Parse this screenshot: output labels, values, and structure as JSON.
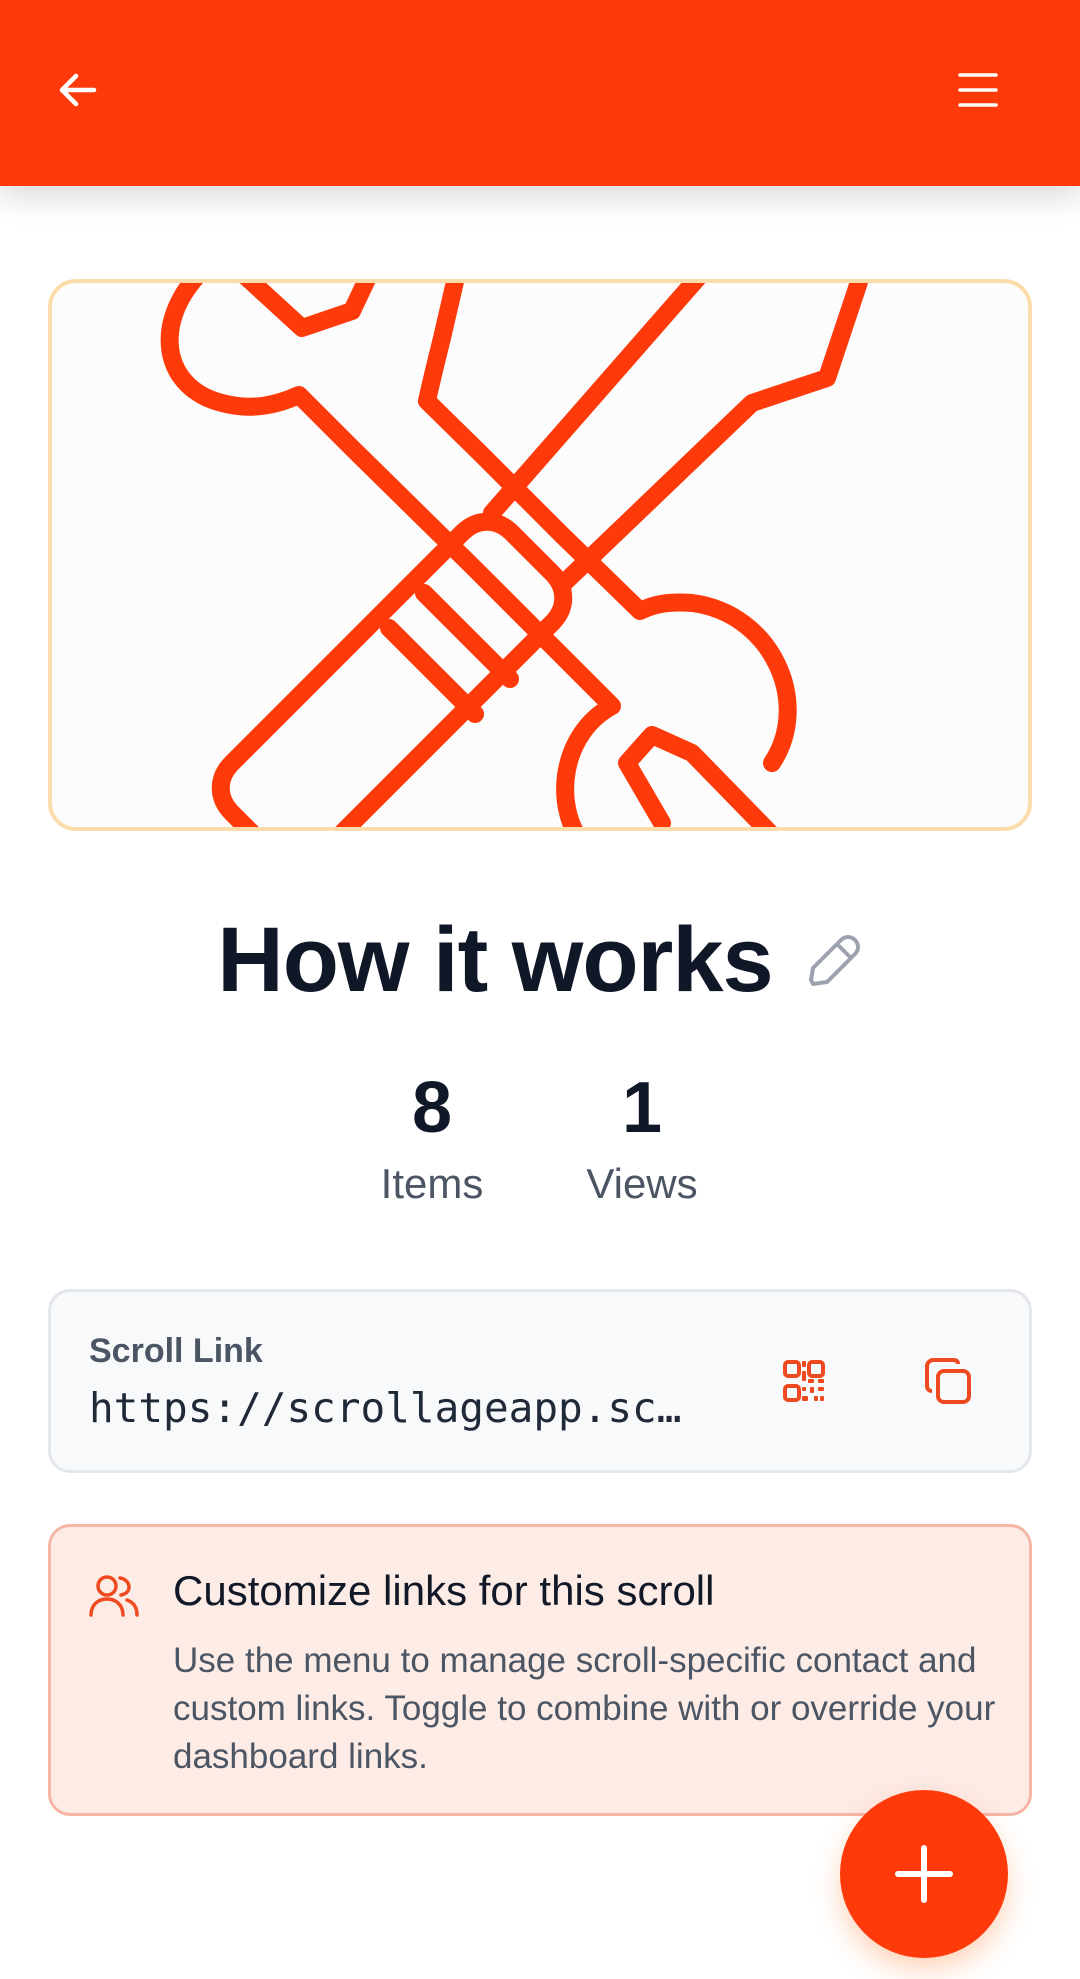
{
  "header": {
    "back_icon": "arrow-left-icon",
    "menu_icon": "hamburger-menu-icon",
    "background_color": "#ff3a0a"
  },
  "hero": {
    "image_icon": "wrench-and-screwdriver-icon",
    "border_color": "#fcdcaa",
    "icon_color": "#ff3a0a"
  },
  "scroll": {
    "title": "How it works",
    "edit_icon": "pencil-icon"
  },
  "stats": [
    {
      "value": "8",
      "label": "Items"
    },
    {
      "value": "1",
      "label": "Views"
    }
  ],
  "scroll_link": {
    "label": "Scroll Link",
    "url": "https://scrollageapp.sc…",
    "qr_icon": "qr-code-icon",
    "copy_icon": "copy-icon"
  },
  "notice": {
    "icon": "users-icon",
    "title": "Customize links for this scroll",
    "body": "Use the menu to manage scroll-specific contact and custom links. Toggle to combine with or override your dashboard links."
  },
  "fab": {
    "icon": "plus-icon",
    "color": "#ff3a0a"
  }
}
